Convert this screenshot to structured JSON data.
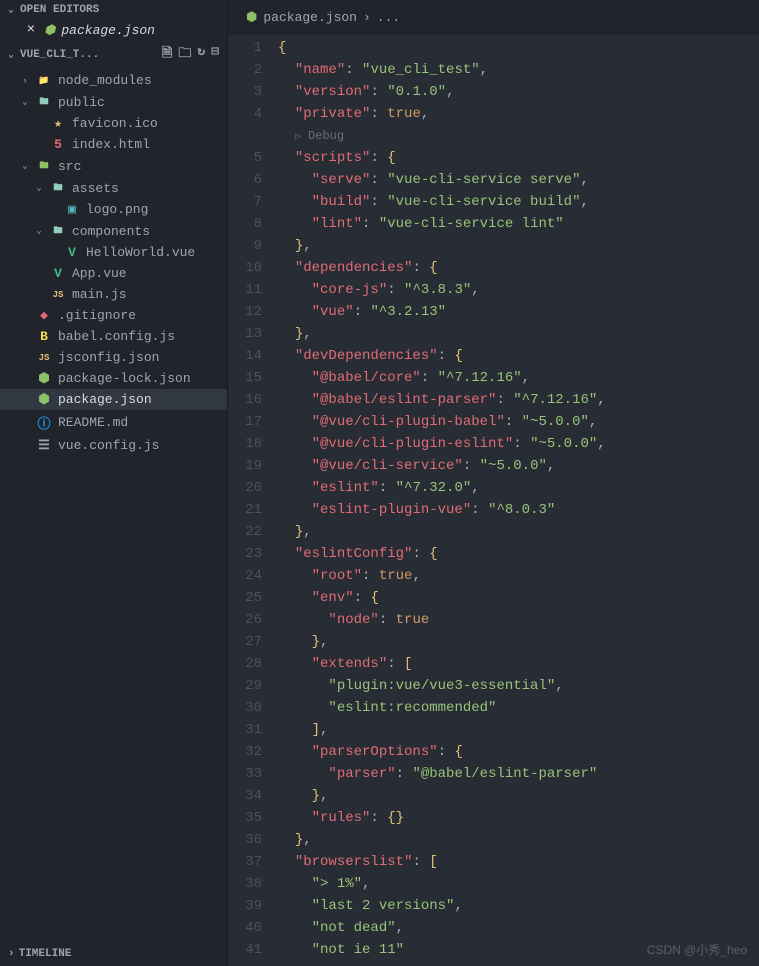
{
  "openEditors": {
    "title": "OPEN EDITORS",
    "items": [
      {
        "name": "package.json"
      }
    ]
  },
  "explorer": {
    "title": "VUE_CLI_T...",
    "tree": [
      {
        "depth": 0,
        "chev": "›",
        "icon": "📁",
        "iconClass": "ic-folder",
        "name": "node_modules"
      },
      {
        "depth": 0,
        "chev": "⌄",
        "icon": "🖿",
        "iconClass": "ic-folder",
        "name": "public"
      },
      {
        "depth": 1,
        "chev": "",
        "icon": "★",
        "iconClass": "ic-fav",
        "name": "favicon.ico"
      },
      {
        "depth": 1,
        "chev": "",
        "icon": "5",
        "iconClass": "ic-html",
        "name": "index.html"
      },
      {
        "depth": 0,
        "chev": "⌄",
        "icon": "🖿",
        "iconClass": "ic-src",
        "name": "src"
      },
      {
        "depth": 1,
        "chev": "⌄",
        "icon": "🖿",
        "iconClass": "ic-folder",
        "name": "assets"
      },
      {
        "depth": 2,
        "chev": "",
        "icon": "▣",
        "iconClass": "ic-png",
        "name": "logo.png"
      },
      {
        "depth": 1,
        "chev": "⌄",
        "icon": "🖿",
        "iconClass": "ic-folder",
        "name": "components"
      },
      {
        "depth": 2,
        "chev": "",
        "icon": "V",
        "iconClass": "ic-vue",
        "name": "HelloWorld.vue"
      },
      {
        "depth": 1,
        "chev": "",
        "icon": "V",
        "iconClass": "ic-vue",
        "name": "App.vue"
      },
      {
        "depth": 1,
        "chev": "",
        "icon": "JS",
        "iconClass": "ic-js",
        "name": "main.js"
      },
      {
        "depth": 0,
        "chev": "",
        "icon": "◆",
        "iconClass": "ic-git",
        "name": ".gitignore"
      },
      {
        "depth": 0,
        "chev": "",
        "icon": "B",
        "iconClass": "ic-babel",
        "name": "babel.config.js"
      },
      {
        "depth": 0,
        "chev": "",
        "icon": "JS",
        "iconClass": "ic-json2",
        "name": "jsconfig.json"
      },
      {
        "depth": 0,
        "chev": "",
        "icon": "⬢",
        "iconClass": "ic-npm",
        "name": "package-lock.json"
      },
      {
        "depth": 0,
        "chev": "",
        "icon": "⬢",
        "iconClass": "ic-npm",
        "name": "package.json",
        "selected": true
      },
      {
        "depth": 0,
        "chev": "",
        "icon": "ⓘ",
        "iconClass": "ic-info",
        "name": "README.md"
      },
      {
        "depth": 0,
        "chev": "",
        "icon": "☰",
        "iconClass": "ic-conf",
        "name": "vue.config.js"
      }
    ]
  },
  "timeline": "TIMELINE",
  "tab": {
    "icon": "⬢",
    "name": "package.json",
    "breadcrumb": "..."
  },
  "debug": "Debug",
  "code": {
    "lines": [
      {
        "n": 1,
        "tokens": [
          {
            "c": "brace",
            "t": "{"
          }
        ],
        "indent": 0
      },
      {
        "n": 2,
        "tokens": [
          {
            "c": "key",
            "t": "\"name\""
          },
          {
            "c": "punc",
            "t": ": "
          },
          {
            "c": "str",
            "t": "\"vue_cli_test\""
          },
          {
            "c": "punc",
            "t": ","
          }
        ],
        "indent": 1
      },
      {
        "n": 3,
        "tokens": [
          {
            "c": "key",
            "t": "\"version\""
          },
          {
            "c": "punc",
            "t": ": "
          },
          {
            "c": "str",
            "t": "\"0.1.0\""
          },
          {
            "c": "punc",
            "t": ","
          }
        ],
        "indent": 1
      },
      {
        "n": 4,
        "tokens": [
          {
            "c": "key",
            "t": "\"private\""
          },
          {
            "c": "punc",
            "t": ": "
          },
          {
            "c": "bool",
            "t": "true"
          },
          {
            "c": "punc",
            "t": ","
          }
        ],
        "indent": 1
      },
      {
        "n": "",
        "debug": true,
        "indent": 1
      },
      {
        "n": 5,
        "tokens": [
          {
            "c": "key",
            "t": "\"scripts\""
          },
          {
            "c": "punc",
            "t": ": "
          },
          {
            "c": "brace",
            "t": "{"
          }
        ],
        "indent": 1
      },
      {
        "n": 6,
        "tokens": [
          {
            "c": "key",
            "t": "\"serve\""
          },
          {
            "c": "punc",
            "t": ": "
          },
          {
            "c": "str",
            "t": "\"vue-cli-service serve\""
          },
          {
            "c": "punc",
            "t": ","
          }
        ],
        "indent": 2
      },
      {
        "n": 7,
        "tokens": [
          {
            "c": "key",
            "t": "\"build\""
          },
          {
            "c": "punc",
            "t": ": "
          },
          {
            "c": "str",
            "t": "\"vue-cli-service build\""
          },
          {
            "c": "punc",
            "t": ","
          }
        ],
        "indent": 2
      },
      {
        "n": 8,
        "tokens": [
          {
            "c": "key",
            "t": "\"lint\""
          },
          {
            "c": "punc",
            "t": ": "
          },
          {
            "c": "str",
            "t": "\"vue-cli-service lint\""
          }
        ],
        "indent": 2
      },
      {
        "n": 9,
        "tokens": [
          {
            "c": "brace",
            "t": "}"
          },
          {
            "c": "punc",
            "t": ","
          }
        ],
        "indent": 1
      },
      {
        "n": 10,
        "tokens": [
          {
            "c": "key",
            "t": "\"dependencies\""
          },
          {
            "c": "punc",
            "t": ": "
          },
          {
            "c": "brace",
            "t": "{"
          }
        ],
        "indent": 1
      },
      {
        "n": 11,
        "tokens": [
          {
            "c": "key",
            "t": "\"core-js\""
          },
          {
            "c": "punc",
            "t": ": "
          },
          {
            "c": "str",
            "t": "\"^3.8.3\""
          },
          {
            "c": "punc",
            "t": ","
          }
        ],
        "indent": 2
      },
      {
        "n": 12,
        "tokens": [
          {
            "c": "key",
            "t": "\"vue\""
          },
          {
            "c": "punc",
            "t": ": "
          },
          {
            "c": "str",
            "t": "\"^3.2.13\""
          }
        ],
        "indent": 2
      },
      {
        "n": 13,
        "tokens": [
          {
            "c": "brace",
            "t": "}"
          },
          {
            "c": "punc",
            "t": ","
          }
        ],
        "indent": 1
      },
      {
        "n": 14,
        "tokens": [
          {
            "c": "key",
            "t": "\"devDependencies\""
          },
          {
            "c": "punc",
            "t": ": "
          },
          {
            "c": "brace",
            "t": "{"
          }
        ],
        "indent": 1
      },
      {
        "n": 15,
        "tokens": [
          {
            "c": "key",
            "t": "\"@babel/core\""
          },
          {
            "c": "punc",
            "t": ": "
          },
          {
            "c": "str",
            "t": "\"^7.12.16\""
          },
          {
            "c": "punc",
            "t": ","
          }
        ],
        "indent": 2
      },
      {
        "n": 16,
        "tokens": [
          {
            "c": "key",
            "t": "\"@babel/eslint-parser\""
          },
          {
            "c": "punc",
            "t": ": "
          },
          {
            "c": "str",
            "t": "\"^7.12.16\""
          },
          {
            "c": "punc",
            "t": ","
          }
        ],
        "indent": 2
      },
      {
        "n": 17,
        "tokens": [
          {
            "c": "key",
            "t": "\"@vue/cli-plugin-babel\""
          },
          {
            "c": "punc",
            "t": ": "
          },
          {
            "c": "str",
            "t": "\"~5.0.0\""
          },
          {
            "c": "punc",
            "t": ","
          }
        ],
        "indent": 2
      },
      {
        "n": 18,
        "tokens": [
          {
            "c": "key",
            "t": "\"@vue/cli-plugin-eslint\""
          },
          {
            "c": "punc",
            "t": ": "
          },
          {
            "c": "str",
            "t": "\"~5.0.0\""
          },
          {
            "c": "punc",
            "t": ","
          }
        ],
        "indent": 2
      },
      {
        "n": 19,
        "tokens": [
          {
            "c": "key",
            "t": "\"@vue/cli-service\""
          },
          {
            "c": "punc",
            "t": ": "
          },
          {
            "c": "str",
            "t": "\"~5.0.0\""
          },
          {
            "c": "punc",
            "t": ","
          }
        ],
        "indent": 2
      },
      {
        "n": 20,
        "tokens": [
          {
            "c": "key",
            "t": "\"eslint\""
          },
          {
            "c": "punc",
            "t": ": "
          },
          {
            "c": "str",
            "t": "\"^7.32.0\""
          },
          {
            "c": "punc",
            "t": ","
          }
        ],
        "indent": 2
      },
      {
        "n": 21,
        "tokens": [
          {
            "c": "key",
            "t": "\"eslint-plugin-vue\""
          },
          {
            "c": "punc",
            "t": ": "
          },
          {
            "c": "str",
            "t": "\"^8.0.3\""
          }
        ],
        "indent": 2
      },
      {
        "n": 22,
        "tokens": [
          {
            "c": "brace",
            "t": "}"
          },
          {
            "c": "punc",
            "t": ","
          }
        ],
        "indent": 1
      },
      {
        "n": 23,
        "tokens": [
          {
            "c": "key",
            "t": "\"eslintConfig\""
          },
          {
            "c": "punc",
            "t": ": "
          },
          {
            "c": "brace",
            "t": "{"
          }
        ],
        "indent": 1
      },
      {
        "n": 24,
        "tokens": [
          {
            "c": "key",
            "t": "\"root\""
          },
          {
            "c": "punc",
            "t": ": "
          },
          {
            "c": "bool",
            "t": "true"
          },
          {
            "c": "punc",
            "t": ","
          }
        ],
        "indent": 2
      },
      {
        "n": 25,
        "tokens": [
          {
            "c": "key",
            "t": "\"env\""
          },
          {
            "c": "punc",
            "t": ": "
          },
          {
            "c": "brace",
            "t": "{"
          }
        ],
        "indent": 2
      },
      {
        "n": 26,
        "tokens": [
          {
            "c": "key",
            "t": "\"node\""
          },
          {
            "c": "punc",
            "t": ": "
          },
          {
            "c": "bool",
            "t": "true"
          }
        ],
        "indent": 3
      },
      {
        "n": 27,
        "tokens": [
          {
            "c": "brace",
            "t": "}"
          },
          {
            "c": "punc",
            "t": ","
          }
        ],
        "indent": 2
      },
      {
        "n": 28,
        "tokens": [
          {
            "c": "key",
            "t": "\"extends\""
          },
          {
            "c": "punc",
            "t": ": "
          },
          {
            "c": "brace",
            "t": "["
          }
        ],
        "indent": 2
      },
      {
        "n": 29,
        "tokens": [
          {
            "c": "str",
            "t": "\"plugin:vue/vue3-essential\""
          },
          {
            "c": "punc",
            "t": ","
          }
        ],
        "indent": 3
      },
      {
        "n": 30,
        "tokens": [
          {
            "c": "str",
            "t": "\"eslint:recommended\""
          }
        ],
        "indent": 3
      },
      {
        "n": 31,
        "tokens": [
          {
            "c": "brace",
            "t": "]"
          },
          {
            "c": "punc",
            "t": ","
          }
        ],
        "indent": 2
      },
      {
        "n": 32,
        "tokens": [
          {
            "c": "key",
            "t": "\"parserOptions\""
          },
          {
            "c": "punc",
            "t": ": "
          },
          {
            "c": "brace",
            "t": "{"
          }
        ],
        "indent": 2
      },
      {
        "n": 33,
        "tokens": [
          {
            "c": "key",
            "t": "\"parser\""
          },
          {
            "c": "punc",
            "t": ": "
          },
          {
            "c": "str",
            "t": "\"@babel/eslint-parser\""
          }
        ],
        "indent": 3
      },
      {
        "n": 34,
        "tokens": [
          {
            "c": "brace",
            "t": "}"
          },
          {
            "c": "punc",
            "t": ","
          }
        ],
        "indent": 2
      },
      {
        "n": 35,
        "tokens": [
          {
            "c": "key",
            "t": "\"rules\""
          },
          {
            "c": "punc",
            "t": ": "
          },
          {
            "c": "brace",
            "t": "{}"
          }
        ],
        "indent": 2
      },
      {
        "n": 36,
        "tokens": [
          {
            "c": "brace",
            "t": "}"
          },
          {
            "c": "punc",
            "t": ","
          }
        ],
        "indent": 1
      },
      {
        "n": 37,
        "tokens": [
          {
            "c": "key",
            "t": "\"browserslist\""
          },
          {
            "c": "punc",
            "t": ": "
          },
          {
            "c": "brace",
            "t": "["
          }
        ],
        "indent": 1
      },
      {
        "n": 38,
        "tokens": [
          {
            "c": "str",
            "t": "\"> 1%\""
          },
          {
            "c": "punc",
            "t": ","
          }
        ],
        "indent": 2
      },
      {
        "n": 39,
        "tokens": [
          {
            "c": "str",
            "t": "\"last 2 versions\""
          },
          {
            "c": "punc",
            "t": ","
          }
        ],
        "indent": 2
      },
      {
        "n": 40,
        "tokens": [
          {
            "c": "str",
            "t": "\"not dead\""
          },
          {
            "c": "punc",
            "t": ","
          }
        ],
        "indent": 2
      },
      {
        "n": 41,
        "tokens": [
          {
            "c": "str",
            "t": "\"not ie 11\""
          }
        ],
        "indent": 2
      }
    ]
  },
  "watermark": "CSDN @小秀_heo"
}
